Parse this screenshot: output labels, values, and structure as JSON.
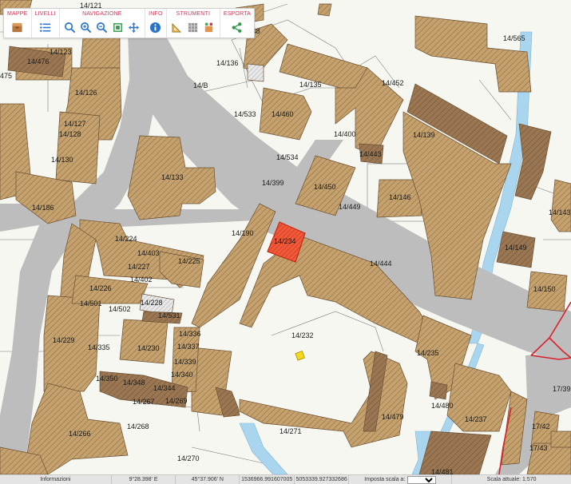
{
  "toolbar": {
    "groups": [
      {
        "label": "MAPPE"
      },
      {
        "label": "LIVELLI"
      },
      {
        "label": "NAVIGAZIONE"
      },
      {
        "label": "INFO"
      },
      {
        "label": "STRUMENTI"
      },
      {
        "label": "ESPORTA"
      }
    ]
  },
  "map_labels": {
    "l14_121": "14/121",
    "l14_123": "14/123",
    "l14_476": "14/476",
    "l475": "475",
    "l14_126": "14/126",
    "l14_127": "14/127",
    "l14_128": "14/128",
    "l14_130": "14/130",
    "l14_186": "14/186",
    "l14_133": "14/133",
    "l14_448": "14/448",
    "l14_136": "14/136",
    "l14_B": "14/B",
    "l14_135": "14/135",
    "l14_533": "14/533",
    "l14_460": "14/460",
    "l14_534": "14/534",
    "l14_399": "14/399",
    "l14_400": "14/400",
    "l14_443": "14/443",
    "l14_452": "14/452",
    "l14_565": "14/565",
    "l14_139": "14/139",
    "l14_450": "14/450",
    "l14_449": "14/449",
    "l14_146": "14/146",
    "l14_190": "14/190",
    "l14_234": "14/234",
    "l14_444": "14/444",
    "l14_143": "14/143",
    "l14_149": "14/149",
    "l14_150": "14/150",
    "l14_224": "14/224",
    "l14_403": "14/403",
    "l14_225": "14/225",
    "l14_227": "14/227",
    "l14_402": "14/402",
    "l14_226": "14/226",
    "l14_501": "14/501",
    "l14_502": "14/502",
    "l14_228": "14/228",
    "l14_531": "14/531",
    "l14_229": "14/229",
    "l14_335": "14/335",
    "l14_230": "14/230",
    "l14_336": "14/336",
    "l14_337": "14/337",
    "l14_339": "14/339",
    "l14_340": "14/340",
    "l14_350": "14/350",
    "l14_348": "14/348",
    "l14_344": "14/344",
    "l14_267": "14/267",
    "l14_269": "14/269",
    "l14_268": "14/268",
    "l14_266": "14/266",
    "l14_270": "14/270",
    "l14_232": "14/232",
    "l14_235": "14/235",
    "l14_271": "14/271",
    "l14_479": "14/479",
    "l14_480": "14/480",
    "l14_237": "14/237",
    "l17_39": "17/39",
    "l17_42": "17/42",
    "l17_43": "17/43",
    "l14_481": "14/481"
  },
  "colors": {
    "building_fill": "#c4a16d",
    "building_dark": "#9a7752",
    "building_stroke": "#6b5032",
    "road": "#bdbdbd",
    "water": "#a9d6ee",
    "selected": "#f05a3a",
    "border_red": "#d9212b",
    "toolbar_accent": "#d6345a",
    "icon_blue": "#2a73c9"
  },
  "statusbar": {
    "info_label": "Informazioni",
    "lon": "9°28.398' E",
    "lat": "45°37.906' N",
    "x_coord": "1536966.991607005",
    "y_coord": "5053339.927332686",
    "scale_select_label": "Imposta scala a:",
    "scale_select_value": "",
    "current_scale": "Scala attuale: 1:570"
  }
}
